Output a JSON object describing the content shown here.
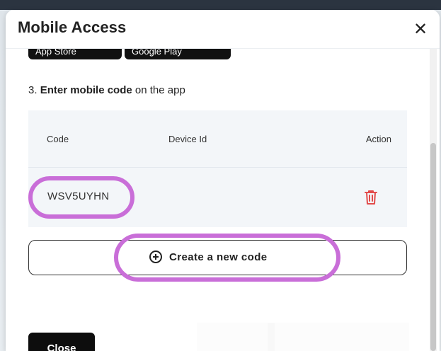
{
  "dialog": {
    "title": "Mobile Access",
    "close_icon_glyph": "✕"
  },
  "stores": {
    "apple_label": "App Store",
    "google_label": "Google Play"
  },
  "step": {
    "prefix": "3. ",
    "bold": "Enter mobile code",
    "suffix": " on the app"
  },
  "table": {
    "columns": [
      "Code",
      "Device Id",
      "Action"
    ],
    "rows": [
      {
        "code": "WSV5UYHN",
        "device_id": ""
      }
    ]
  },
  "buttons": {
    "create": "Create a new code",
    "close": "Close"
  },
  "colors": {
    "highlight": "#c96ed8",
    "delete": "#e24b4b",
    "close_bg": "#0d0d0d"
  },
  "icons": {
    "delete": "trash-icon",
    "create": "plus-circle-icon",
    "close": "close-icon"
  }
}
